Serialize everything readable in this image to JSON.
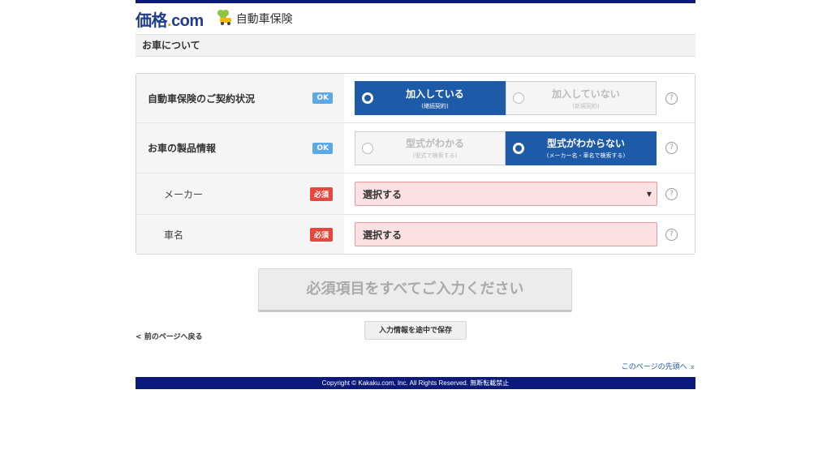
{
  "header": {
    "logo_main": "価格",
    "logo_dot": ".",
    "logo_com": "com",
    "service_name": "自動車保険"
  },
  "section": {
    "title": "お車について"
  },
  "form": {
    "rows": [
      {
        "label": "自動車保険のご契約状況",
        "badge": "OK",
        "options": [
          {
            "main": "加入している",
            "sub": "(継続契約)",
            "selected": true
          },
          {
            "main": "加入していない",
            "sub": "(新規契約)",
            "selected": false
          }
        ],
        "help": "?"
      },
      {
        "label": "お車の製品情報",
        "badge": "OK",
        "options": [
          {
            "main": "型式がわかる",
            "sub": "(型式で検索する)",
            "selected": false
          },
          {
            "main": "型式がわからない",
            "sub": "(メーカー名・車名で検索する)",
            "selected": true
          }
        ],
        "help": "?"
      },
      {
        "label": "メーカー",
        "badge": "必須",
        "value": "選択する",
        "caret": "▼",
        "help": "?"
      },
      {
        "label": "車名",
        "badge": "必須",
        "value": "選択する",
        "help": "?"
      }
    ]
  },
  "actions": {
    "submit_label": "必須項目をすべてご入力ください",
    "back_label": "前のページへ戻る",
    "back_arrow": "<",
    "save_label": "入力情報を途中で保存",
    "pagetop_label": "このページの先頭へ",
    "pagetop_arrow": "⌅"
  },
  "footer": {
    "copyright": "Copyright © Kakaku.com, Inc. All Rights Reserved. 無断転載禁止"
  },
  "colors": {
    "brand_navy": "#0b1a7a",
    "selected_blue": "#1d5aa8",
    "ok_badge": "#5aa9e6",
    "required_badge": "#e5483e",
    "required_field": "#fbe1e1"
  }
}
